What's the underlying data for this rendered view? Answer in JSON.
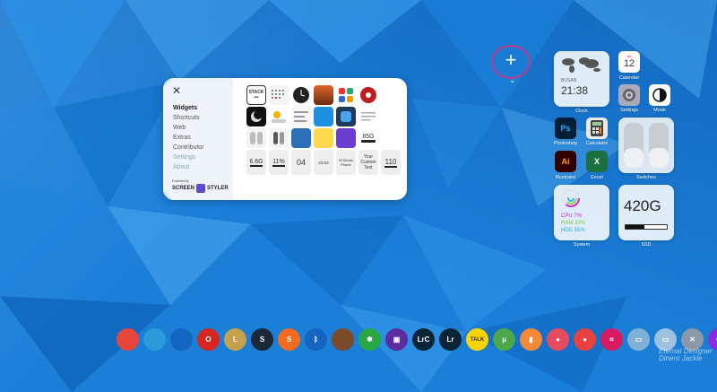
{
  "add_button": {
    "label": "+",
    "chevron": "⌄"
  },
  "panel": {
    "close": "✕",
    "menu": [
      "Widgets",
      "Shortcuts",
      "Web",
      "Extras",
      "Contributor",
      "Settings",
      "About"
    ],
    "powered_by": "Powered by",
    "brand_left": "SCREEN",
    "brand_right": "STYLER",
    "tiles": {
      "stack": "STACK",
      "stack_dots": "•••",
      "storage": "85G",
      "disk": "6.6G",
      "pct": "11%",
      "day": "04",
      "time": "23:53",
      "sample_text": "Hi Steam Phone",
      "custom_text": "Your Custom Text",
      "num": "110"
    }
  },
  "widgets": {
    "clock": {
      "city": "BUSAN",
      "time": "21:38",
      "label": "Clock"
    },
    "calendar": {
      "month": "FRI",
      "day": "12",
      "label": "Calendar"
    },
    "settings_label": "Settings",
    "mode_label": "Mode",
    "photoshop": {
      "abbr": "Ps",
      "label": "Photoshop"
    },
    "calculator_label": "Calculator",
    "switches_label": "Switches",
    "illustrator": {
      "abbr": "Ai",
      "label": "Illustrator"
    },
    "excel": {
      "abbr": "X",
      "label": "Excel"
    },
    "system": {
      "cpu": "CPU 7%",
      "ram": "RAM 33%",
      "hdd": "HDD 55%",
      "label": "System"
    },
    "ssd": {
      "value": "420G",
      "label": "SSD",
      "fill": 0.45
    }
  },
  "dock": {
    "items": [
      {
        "name": "chrome",
        "text": "",
        "color": "#e8453c"
      },
      {
        "name": "edge",
        "text": "",
        "color": "#2a9bd8"
      },
      {
        "name": "edge-dev",
        "text": "",
        "color": "#1565c0"
      },
      {
        "name": "opera",
        "text": "O",
        "color": "#d7261d"
      },
      {
        "name": "league",
        "text": "L",
        "color": "#c6a14d"
      },
      {
        "name": "steam",
        "text": "S",
        "color": "#1b2838"
      },
      {
        "name": "s-app",
        "text": "S",
        "color": "#f26b21"
      },
      {
        "name": "bluetooth",
        "text": "ᛒ",
        "color": "#1565c0"
      },
      {
        "name": "image-app",
        "text": "",
        "color": "#7b4a2a"
      },
      {
        "name": "share",
        "text": "✱",
        "color": "#2aa745"
      },
      {
        "name": "cpu-app",
        "text": "▣",
        "color": "#5b2ba0"
      },
      {
        "name": "lightroom-classic",
        "text": "LrC",
        "color": "#0b2538"
      },
      {
        "name": "lightroom",
        "text": "Lr",
        "color": "#0b2538"
      },
      {
        "name": "talk",
        "text": "TALK",
        "color": "#f5d400"
      },
      {
        "name": "utorrent",
        "text": "µ",
        "color": "#4aa84a"
      },
      {
        "name": "orange-app",
        "text": "▮",
        "color": "#f28a3a"
      },
      {
        "name": "camera-app",
        "text": "●",
        "color": "#e84a5f"
      },
      {
        "name": "paw-app",
        "text": "●",
        "color": "#e94040"
      },
      {
        "name": "crop-app",
        "text": "⌗",
        "color": "#d81b60"
      },
      {
        "name": "monitor-app",
        "text": "▭",
        "color": "#7fb0d8"
      },
      {
        "name": "window-app",
        "text": "▭",
        "color": "#9ec1e0"
      },
      {
        "name": "tools-app",
        "text": "✕",
        "color": "#8a9aaa"
      },
      {
        "name": "power",
        "text": "⏻",
        "color": "#8a2be2"
      },
      {
        "name": "recycle-bin",
        "text": "🗑",
        "color": "#c9d6e2"
      }
    ]
  },
  "watermark": "Eternal Designer Dinero Jackie"
}
